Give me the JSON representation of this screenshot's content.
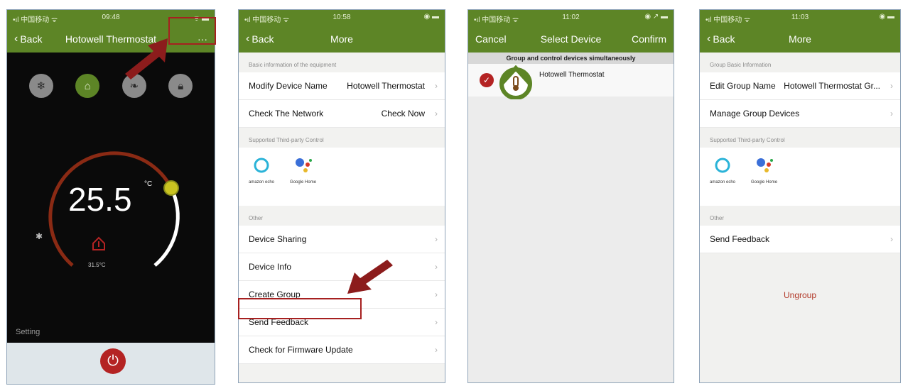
{
  "colors": {
    "header": "#5d8526",
    "highlight": "#a62020",
    "accent_red": "#b42323"
  },
  "phone1": {
    "status": {
      "carrier": "•ıl 中国移动 ᯤ",
      "time": "09:48",
      "battery": "ᯤ ▬"
    },
    "back_label": "Back",
    "title": "Hotowell Thermostat",
    "menu_label": "···",
    "mode_icons": [
      "snowflake-icon",
      "program-icon",
      "leaf-icon",
      "lock-icon"
    ],
    "temperature": "25.5",
    "unit": "°C",
    "setpoint": "31.5°C",
    "setting_label": "Setting",
    "power_icon": "⏻"
  },
  "phone2": {
    "status": {
      "carrier": "•ıl 中国移动 ᯤ",
      "time": "10:58",
      "battery": "◉ ▬"
    },
    "back_label": "Back",
    "title": "More",
    "sections": {
      "basic": "Basic information of the equipment",
      "third_party": "Supported Third-party Control",
      "other": "Other"
    },
    "basic_rows": [
      {
        "label": "Modify Device Name",
        "value": "Hotowell Thermostat"
      },
      {
        "label": "Check The Network",
        "value": "Check Now"
      }
    ],
    "third_party": [
      "amazon echo",
      "Google Home"
    ],
    "other_rows": [
      "Device Sharing",
      "Device Info",
      "Create Group",
      "Send Feedback",
      "Check for Firmware Update"
    ]
  },
  "phone3": {
    "status": {
      "carrier": "•ıl 中国移动 ᯤ",
      "time": "11:02",
      "battery": "◉ ↗ ▬"
    },
    "cancel_label": "Cancel",
    "title": "Select Device",
    "confirm_label": "Confirm",
    "banner": "Group and control devices simultaneously",
    "device_name": "Hotowell Thermostat",
    "check_mark": "✓"
  },
  "phone4": {
    "status": {
      "carrier": "•ıl 中国移动 ᯤ",
      "time": "11:03",
      "battery": "◉ ▬"
    },
    "back_label": "Back",
    "title": "More",
    "sections": {
      "basic": "Group Basic Information",
      "third_party": "Supported Third-party Control",
      "other": "Other"
    },
    "rows": [
      {
        "label": "Edit Group Name",
        "value": "Hotowell Thermostat Gr..."
      },
      {
        "label": "Manage Group Devices",
        "value": ""
      }
    ],
    "third_party": [
      "amazon echo",
      "Google Home"
    ],
    "other_rows": [
      "Send Feedback"
    ],
    "ungroup_label": "Ungroup"
  }
}
